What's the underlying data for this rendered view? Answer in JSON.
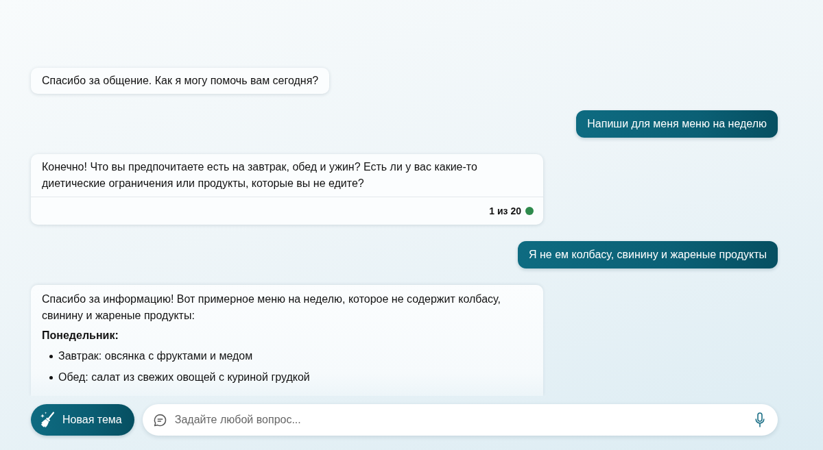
{
  "messages": [
    {
      "kind": "bot",
      "blocks": [
        {
          "kind": "paragraph",
          "text": "Спасибо за общение. Как я могу помочь вам сегодня?"
        }
      ]
    },
    {
      "kind": "user",
      "text": "Напиши для меня меню на неделю"
    },
    {
      "kind": "bot",
      "blocks": [
        {
          "kind": "paragraph",
          "text": "Конечно! Что вы предпочитаете есть на завтрак, обед и ужин? Есть ли у вас какие-то диетические ограничения или продукты, которые вы не едите?"
        }
      ],
      "counter": "1 из 20"
    },
    {
      "kind": "user",
      "text": "Я не ем колбасу, свинину и жареные продукты"
    },
    {
      "kind": "bot",
      "blocks": [
        {
          "kind": "paragraph",
          "text": "Спасибо за информацию! Вот примерное меню на неделю, которое не содержит колбасу, свинину и жареные продукты:"
        },
        {
          "kind": "heading",
          "text": "Понедельник:"
        },
        {
          "kind": "list",
          "items": [
            "Завтрак: овсянка с фруктами и медом",
            "Обед: салат из свежих овощей с куриной грудкой"
          ]
        }
      ]
    }
  ],
  "composer": {
    "new_topic_button": {
      "label": "Новая тема"
    },
    "input": {
      "placeholder": "Задайте любой вопрос..."
    }
  }
}
